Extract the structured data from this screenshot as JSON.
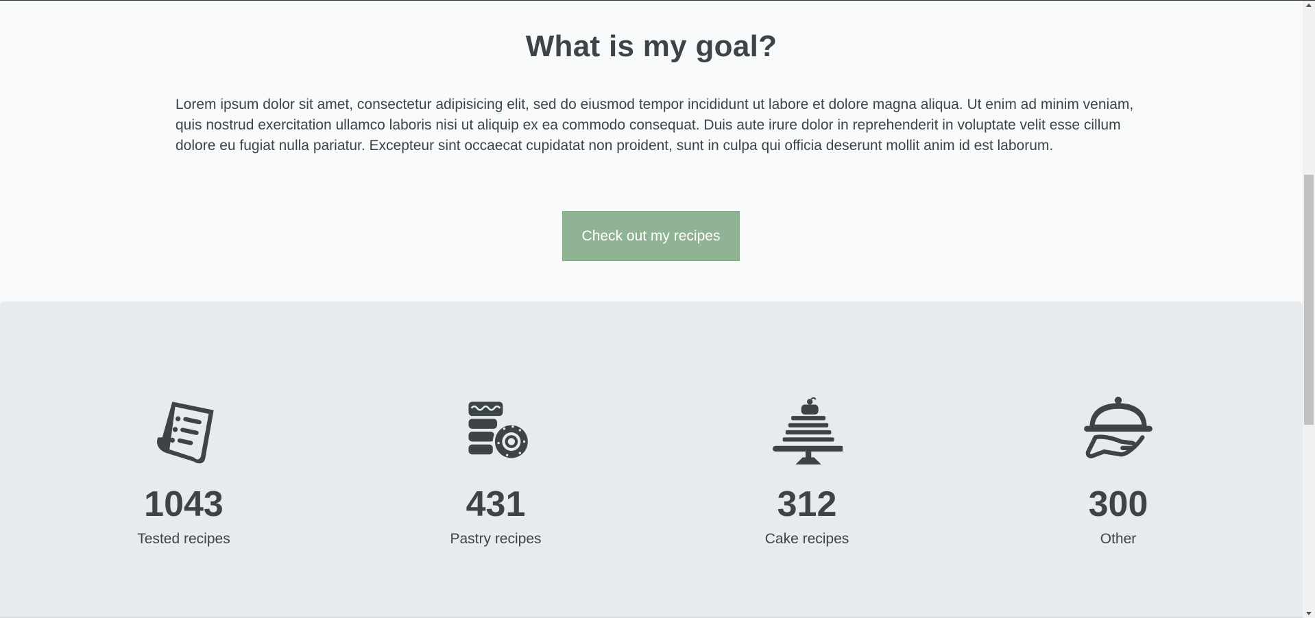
{
  "goal": {
    "title": "What is my goal?",
    "text": "Lorem ipsum dolor sit amet, consectetur adipisicing elit, sed do eiusmod tempor incididunt ut labore et dolore magna aliqua. Ut enim ad minim veniam, quis nostrud exercitation ullamco laboris nisi ut aliquip ex ea commodo consequat. Duis aute irure dolor in reprehenderit in voluptate velit esse cillum dolore eu fugiat nulla pariatur. Excepteur sint occaecat cupidatat non proident, sunt in culpa qui officia deserunt mollit anim id est laborum.",
    "button_label": "Check out my recipes"
  },
  "stats": [
    {
      "icon": "recipe-scroll-icon",
      "value": "1043",
      "label": "Tested recipes"
    },
    {
      "icon": "pastry-donut-icon",
      "value": "431",
      "label": "Pastry recipes"
    },
    {
      "icon": "cake-icon",
      "value": "312",
      "label": "Cake recipes"
    },
    {
      "icon": "serving-cloche-icon",
      "value": "300",
      "label": "Other"
    }
  ],
  "colors": {
    "page_background": "#f8f9fa",
    "stats_background": "#e8ebed",
    "text": "#3d4446",
    "button": "#8fb393"
  }
}
